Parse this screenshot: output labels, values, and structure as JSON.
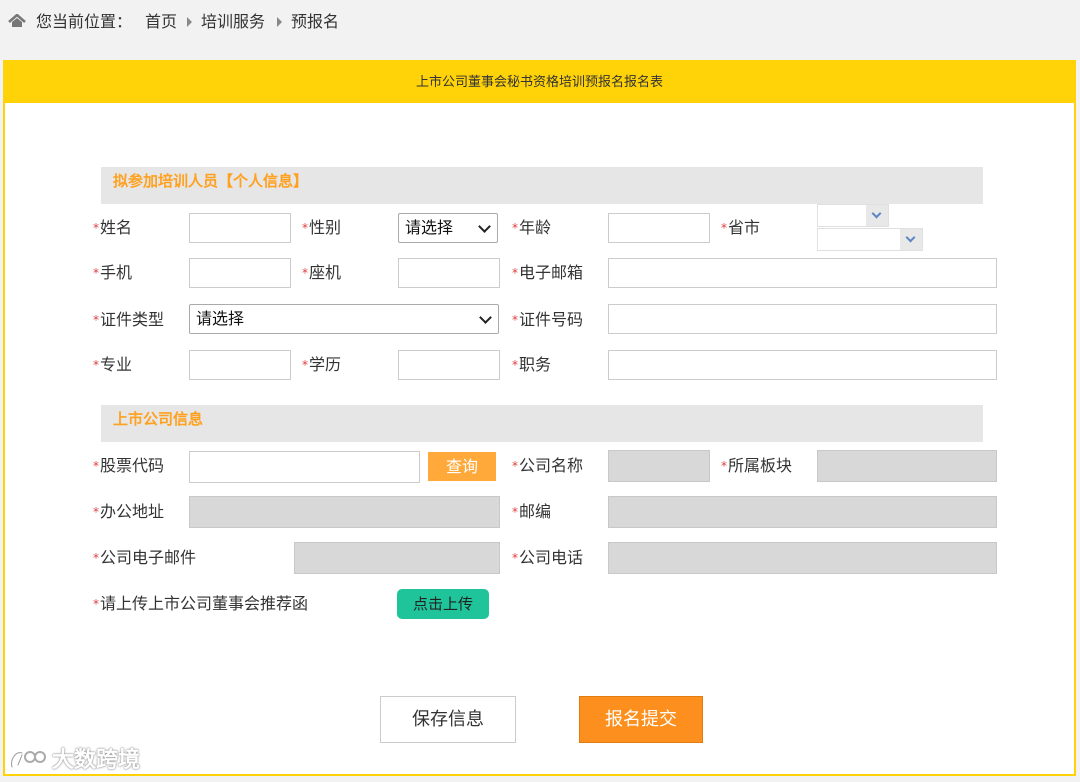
{
  "breadcrumb": {
    "prefix": "您当前位置：",
    "items": [
      "首页",
      "培训服务",
      "预报名"
    ]
  },
  "form_title": "上市公司董事会秘书资格培训预报名报名表",
  "required_mark": "*",
  "personal": {
    "section_title": "拟参加培训人员【个人信息】",
    "name_label": "姓名",
    "gender_label": "性别",
    "gender_value": "请选择",
    "age_label": "年龄",
    "province_label": "省市",
    "mobile_label": "手机",
    "landline_label": "座机",
    "email_label": "电子邮箱",
    "id_type_label": "证件类型",
    "id_type_value": "请选择",
    "id_number_label": "证件号码",
    "major_label": "专业",
    "education_label": "学历",
    "position_label": "职务"
  },
  "company": {
    "section_title": "上市公司信息",
    "stock_code_label": "股票代码",
    "query_button": "查询",
    "company_name_label": "公司名称",
    "board_label": "所属板块",
    "address_label": "办公地址",
    "zip_label": "邮编",
    "company_email_label": "公司电子邮件",
    "company_phone_label": "公司电话",
    "upload_label": "请上传上市公司董事会推荐函",
    "upload_button": "点击上传"
  },
  "actions": {
    "save": "保存信息",
    "submit": "报名提交"
  },
  "watermark": "大数跨境",
  "colors": {
    "accent_yellow": "#ffd308",
    "section_text": "#ffa11f",
    "required_red": "#e13d3d",
    "query_orange": "#ffa93a",
    "submit_orange": "#fc8f1d",
    "upload_teal": "#1fc49a"
  }
}
